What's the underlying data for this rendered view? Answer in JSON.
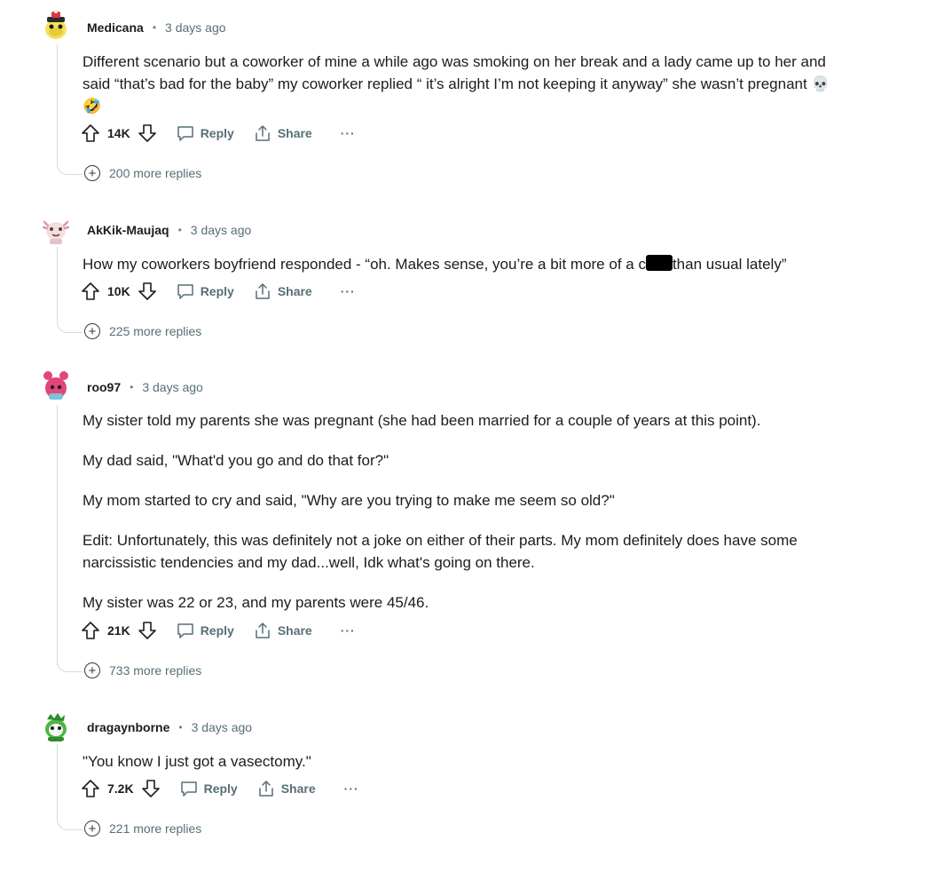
{
  "labels": {
    "reply": "Reply",
    "share": "Share",
    "more": "···"
  },
  "comments": [
    {
      "author": "Medicana",
      "time": "3 days ago",
      "line1": "Different scenario but a coworker of mine a while ago was smoking on her break and a lady came up to her and",
      "line2": "said “that’s bad for the baby” my coworker replied “ it’s alright I’m not keeping it anyway” she wasn’t pregnant 💀",
      "line3": "🤣",
      "votes": "14K",
      "more_replies": "200 more replies"
    },
    {
      "author": "AkKik-Maujaq",
      "time": "3 days ago",
      "text_before": "How my coworkers boyfriend responded - “oh. Makes sense, you’re a bit more of a c",
      "text_after": "than usual lately”",
      "votes": "10K",
      "more_replies": "225 more replies"
    },
    {
      "author": "roo97",
      "time": "3 days ago",
      "paragraphs": [
        "My sister told my parents she was pregnant (she had been married for a couple of years at this point).",
        "My dad said, \"What'd you go and do that for?\"",
        "My mom started to cry and said, \"Why are you trying to make me seem so old?\"",
        "Edit: Unfortunately, this was definitely not a joke on either of their parts. My mom definitely does have some narcissistic tendencies and my dad...well, Idk what's going on there.",
        "My sister was 22 or 23, and my parents were 45/46."
      ],
      "votes": "21K",
      "more_replies": "733 more replies"
    },
    {
      "author": "dragaynborne",
      "time": "3 days ago",
      "text": "\"You know I just got a vasectomy.\"",
      "votes": "7.2K",
      "more_replies": "221 more replies"
    }
  ],
  "colors": {
    "meta": "#576f76",
    "text": "#1c1c1c",
    "thread": "#d6dadc"
  }
}
